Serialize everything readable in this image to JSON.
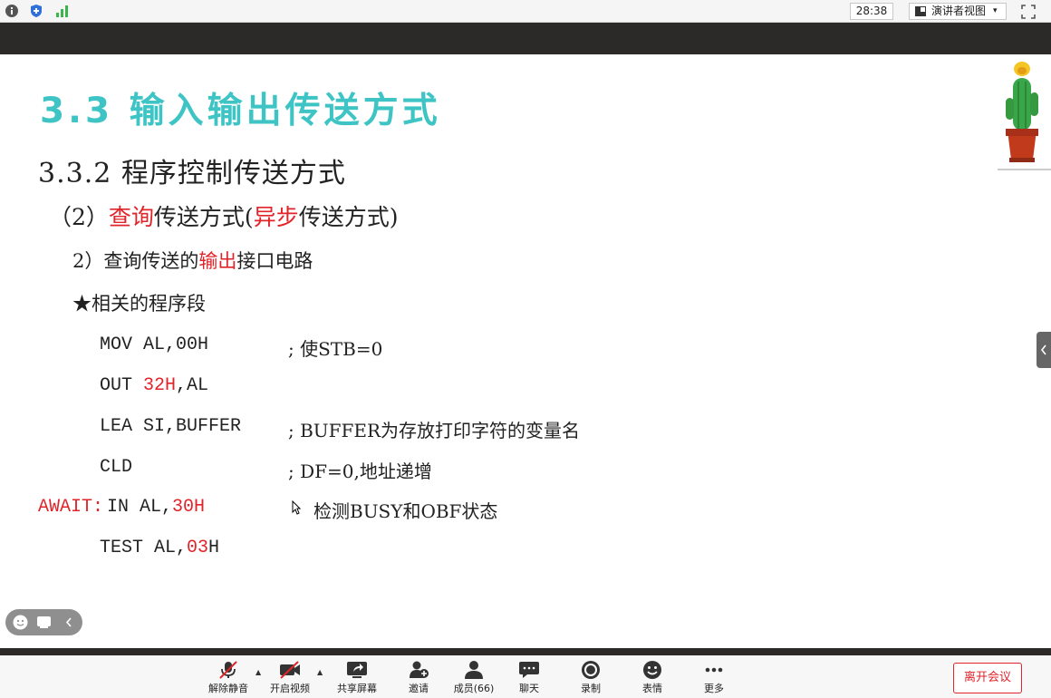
{
  "topbar": {
    "icons": [
      "info-icon",
      "shield-icon",
      "signal-icon"
    ],
    "timer": "28:38",
    "view_label": "演讲者视图",
    "view_caret": "▾"
  },
  "slide": {
    "section_title": "3.3  输入输出传送方式",
    "subtitle": "3.3.2 程序控制传送方式",
    "line2": {
      "p1": "（2）",
      "p2": "查询",
      "p3": "传送方式(",
      "p4": "异步",
      "p5": "传送方式)"
    },
    "line3": {
      "p1": "2）查询传送的",
      "p2": "输出",
      "p3": "接口电路"
    },
    "line4": "★相关的程序段",
    "code": [
      {
        "label": "",
        "parts": [
          {
            "t": "MOV AL,00H",
            "red": false
          }
        ],
        "comment": ";  使STB=0"
      },
      {
        "label": "",
        "parts": [
          {
            "t": "OUT ",
            "red": false
          },
          {
            "t": "32H",
            "red": true
          },
          {
            "t": ",AL",
            "red": false
          }
        ],
        "comment": ""
      },
      {
        "label": "",
        "parts": [
          {
            "t": "LEA SI,BUFFER",
            "red": false
          }
        ],
        "comment": ";  BUFFER为存放打印字符的变量名"
      },
      {
        "label": "",
        "parts": [
          {
            "t": "CLD",
            "red": false
          }
        ],
        "comment": ";  DF=0,地址递增"
      },
      {
        "label": "AWAIT:",
        "parts": [
          {
            "t": "IN  AL,",
            "red": false
          },
          {
            "t": "30H",
            "red": true
          }
        ],
        "comment": "检测BUSY和OBF状态"
      },
      {
        "label": "",
        "parts": [
          {
            "t": "TEST AL,",
            "red": false
          },
          {
            "t": "03",
            "red": true
          },
          {
            "t": "H",
            "red": false
          }
        ],
        "comment": ""
      }
    ],
    "colors": {
      "title": "#3ec4c4",
      "accent": "#e1242a"
    }
  },
  "toolbar": {
    "items": [
      {
        "label": "解除静音",
        "icon": "mic-muted-icon"
      },
      {
        "label": "开启视频",
        "icon": "video-off-icon"
      },
      {
        "label": "共享屏幕",
        "icon": "share-screen-icon"
      },
      {
        "label": "邀请",
        "icon": "invite-icon"
      },
      {
        "label": "成员(66)",
        "icon": "members-icon"
      },
      {
        "label": "聊天",
        "icon": "chat-icon"
      },
      {
        "label": "录制",
        "icon": "record-icon"
      },
      {
        "label": "表情",
        "icon": "emoji-icon"
      },
      {
        "label": "更多",
        "icon": "more-icon"
      }
    ],
    "leave_label": "离开会议"
  }
}
